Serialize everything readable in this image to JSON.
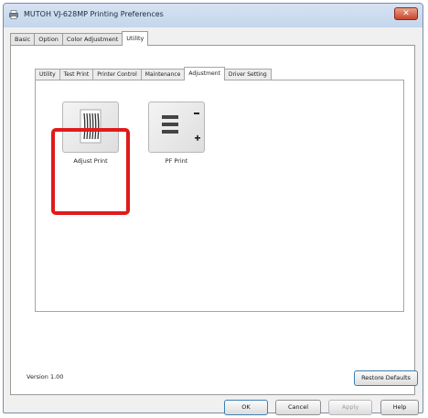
{
  "window": {
    "title": "MUTOH VJ-628MP Printing Preferences",
    "close_label": "✕"
  },
  "outer_tabs": [
    {
      "label": "Basic",
      "active": false
    },
    {
      "label": "Option",
      "active": false
    },
    {
      "label": "Color Adjustment",
      "active": false
    },
    {
      "label": "Utility",
      "active": true
    }
  ],
  "inner_tabs": [
    {
      "label": "Utility",
      "active": false
    },
    {
      "label": "Test Print",
      "active": false
    },
    {
      "label": "Printer Control",
      "active": false
    },
    {
      "label": "Maintenance",
      "active": false
    },
    {
      "label": "Adjustment",
      "active": true
    },
    {
      "label": "Driver Setting",
      "active": false
    }
  ],
  "tiles": [
    {
      "label": "Adjust Print",
      "icon": "adjust-print-icon",
      "highlighted": true
    },
    {
      "label": "PF Print",
      "icon": "pf-print-icon",
      "highlighted": false
    }
  ],
  "footer": {
    "version": "Version 1.00",
    "restore_label": "Restore Defaults"
  },
  "dialog_buttons": {
    "ok": "OK",
    "cancel": "Cancel",
    "apply": "Apply",
    "help": "Help"
  },
  "colors": {
    "highlight": "#e11a1a",
    "close_button": "#c8462c"
  }
}
